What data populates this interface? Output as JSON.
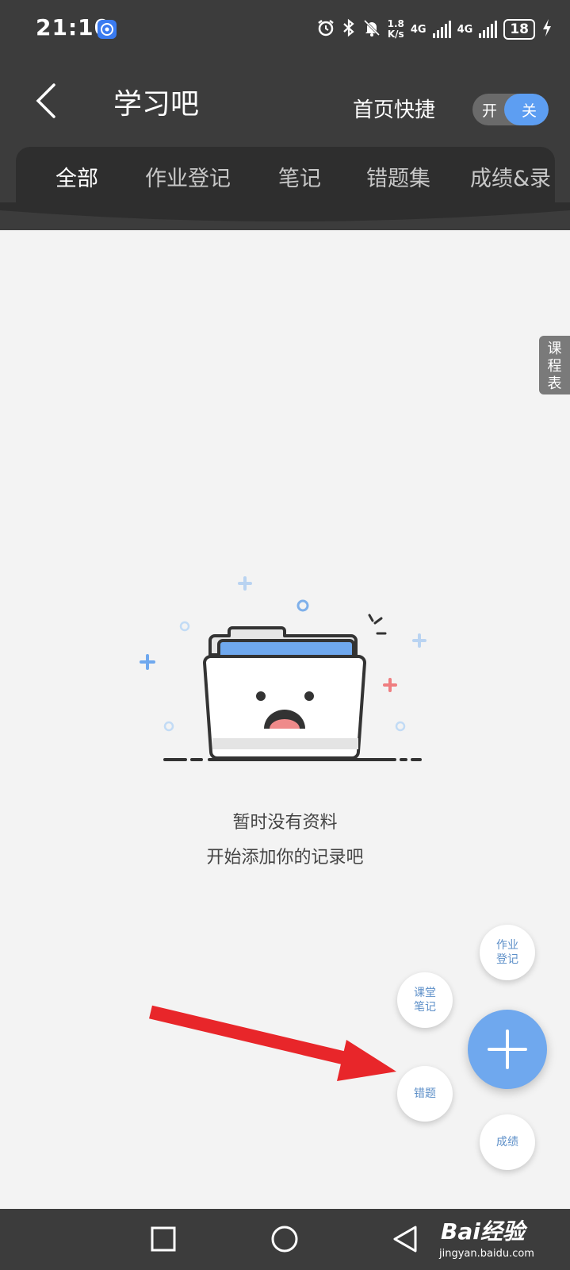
{
  "status_bar": {
    "time": "21:10",
    "net_speed_value": "1.8",
    "net_speed_unit": "K/s",
    "network_1": "4G",
    "network_2": "4G",
    "battery": "18"
  },
  "header": {
    "title": "学习吧",
    "quick_label": "首页快捷",
    "toggle_on_label": "开",
    "toggle_off_label": "关"
  },
  "tabs": [
    {
      "label": "全部",
      "active": true
    },
    {
      "label": "作业登记",
      "active": false
    },
    {
      "label": "笔记",
      "active": false
    },
    {
      "label": "错题集",
      "active": false
    },
    {
      "label": "成绩&录",
      "active": false
    }
  ],
  "side_tab": {
    "line1": "课",
    "line2": "程",
    "line3": "表"
  },
  "empty_state": {
    "title": "暂时没有资料",
    "subtitle": "开始添加你的记录吧"
  },
  "fab_menu": {
    "homework": {
      "line1": "作业",
      "line2": "登记"
    },
    "class_notes": {
      "line1": "课堂",
      "line2": "笔记"
    },
    "mistakes": "错题",
    "grades": "成绩"
  },
  "watermark": {
    "main": "Bai经验",
    "sub": "jingyan.baidu.com"
  },
  "colors": {
    "header": "#3c3c3c",
    "accent_blue": "#6fa8ee",
    "background": "#f3f3f3",
    "arrow_red": "#e8262a"
  },
  "icons": [
    "app-notification-icon",
    "alarm-icon",
    "bluetooth-icon",
    "mute-icon",
    "charging-icon",
    "back-icon",
    "plus-icon",
    "square-nav-icon",
    "circle-nav-icon",
    "triangle-nav-icon"
  ]
}
